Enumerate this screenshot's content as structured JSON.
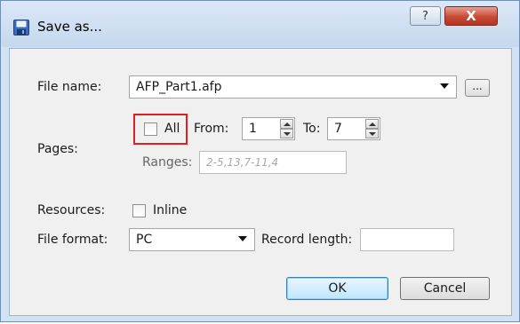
{
  "window": {
    "title": "Save as...",
    "help_label": "?",
    "close_label": "X"
  },
  "file_name": {
    "label": "File name:",
    "value": "AFP_Part1.afp",
    "browse_label": "..."
  },
  "pages": {
    "label": "Pages:",
    "all_label": "All",
    "from_label": "From:",
    "from_value": "1",
    "to_label": "To:",
    "to_value": "7",
    "ranges_label": "Ranges:",
    "ranges_placeholder": "2-5,13,7-11,4"
  },
  "resources": {
    "label": "Resources:",
    "inline_label": "Inline"
  },
  "file_format": {
    "label": "File format:",
    "value": "PC",
    "record_length_label": "Record length:",
    "record_length_value": ""
  },
  "buttons": {
    "ok_label": "OK",
    "cancel_label": "Cancel"
  },
  "colors": {
    "highlight": "#e02020",
    "ok_button": "#bee6fd",
    "close_button": "#c74a36"
  }
}
